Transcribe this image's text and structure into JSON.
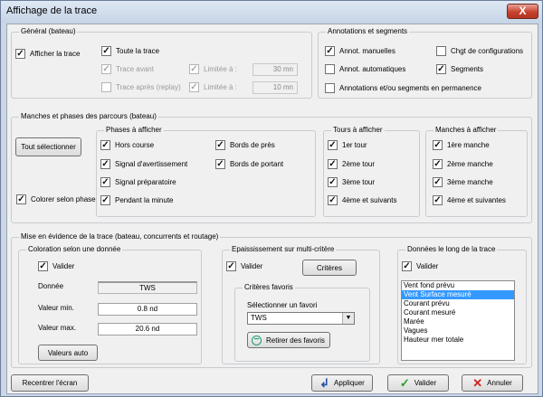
{
  "window": {
    "title": "Affichage de la trace",
    "close": "X"
  },
  "general": {
    "legend": "Général (bateau)",
    "afficher_trace": {
      "label": "Afficher la trace",
      "checked": true
    },
    "toute_trace": {
      "label": "Toute la trace",
      "checked": true
    },
    "trace_avant": {
      "label": "Trace avant",
      "checked": true,
      "enabled": false
    },
    "trace_apres": {
      "label": "Trace après (replay)",
      "checked": false,
      "enabled": false
    },
    "limitee1": {
      "label": "Limitée à :",
      "checked": true,
      "value": "30 mn"
    },
    "limitee2": {
      "label": "Limitée à :",
      "checked": true,
      "value": "10 mn"
    }
  },
  "annotations": {
    "legend": "Annotations et segments",
    "manuelles": {
      "label": "Annot. manuelles",
      "checked": true
    },
    "chgt": {
      "label": "Chgt de configurations",
      "checked": false
    },
    "automatiques": {
      "label": "Annot. automatiques",
      "checked": false
    },
    "segments": {
      "label": "Segments",
      "checked": true
    },
    "permanence": {
      "label": "Annotations et/ou segments en permanence",
      "checked": false
    }
  },
  "manches": {
    "legend": "Manches et phases des parcours (bateau)",
    "tout_selectionner": "Tout sélectionner",
    "colorer": {
      "label": "Colorer selon phase",
      "checked": true
    },
    "phases_legend": "Phases à afficher",
    "phases": [
      {
        "label": "Hors course",
        "checked": true
      },
      {
        "label": "Signal d'avertissement",
        "checked": true
      },
      {
        "label": "Signal préparatoire",
        "checked": true
      },
      {
        "label": "Pendant la minute",
        "checked": true
      },
      {
        "label": "Bords de près",
        "checked": true
      },
      {
        "label": "Bords de portant",
        "checked": true
      }
    ],
    "tours_legend": "Tours à afficher",
    "tours": [
      {
        "label": "1er tour",
        "checked": true
      },
      {
        "label": "2ème tour",
        "checked": true
      },
      {
        "label": "3ème tour",
        "checked": true
      },
      {
        "label": "4ème et suivants",
        "checked": true
      }
    ],
    "manches_legend": "Manches à afficher",
    "manches_list": [
      {
        "label": "1ère manche",
        "checked": true
      },
      {
        "label": "2ème manche",
        "checked": true
      },
      {
        "label": "3ème manche",
        "checked": true
      },
      {
        "label": "4ème et suivantes",
        "checked": true
      }
    ]
  },
  "mise": {
    "legend": "Mise en évidence de la trace (bateau, concurrents et routage)",
    "coloration": {
      "legend": "Coloration selon une donnée",
      "valider": {
        "label": "Valider",
        "checked": true
      },
      "donnee_label": "Donnée",
      "donnee_value": "TWS",
      "min_label": "Valeur min.",
      "min_value": "0.8 nd",
      "max_label": "Valeur max.",
      "max_value": "20.6 nd",
      "auto_button": "Valeurs auto"
    },
    "epaississement": {
      "legend": "Epaississement sur multi-critère",
      "valider": {
        "label": "Valider",
        "checked": true
      },
      "criteres_button": "Critères",
      "favoris_legend": "Critères favoris",
      "select_label": "Sélectionner un favori",
      "select_value": "TWS",
      "retirer_button": "Retirer des favoris"
    },
    "donnees": {
      "legend": "Données le long de la trace",
      "valider": {
        "label": "Valider",
        "checked": true
      },
      "items": [
        "Vent fond prévu",
        "Vent Surface mesuré",
        "Courant prévu",
        "Courant mesuré",
        "Marée",
        "Vagues",
        "Hauteur mer totale"
      ],
      "selected_index": 1
    }
  },
  "footer": {
    "recentrer": "Recentrer l'écran",
    "appliquer": "Appliquer",
    "valider": "Valider",
    "annuler": "Annuler"
  },
  "glyphs": {
    "check": "✓",
    "dropdown": "▼",
    "ok": "✓",
    "cancel": "✕",
    "remove": "−",
    "apply": "↲"
  },
  "colors": {
    "selection": "#3399ff",
    "ok_icon": "#2a9d2a",
    "cancel_icon": "#d02020",
    "remove_icon": "#1e9a6e"
  }
}
